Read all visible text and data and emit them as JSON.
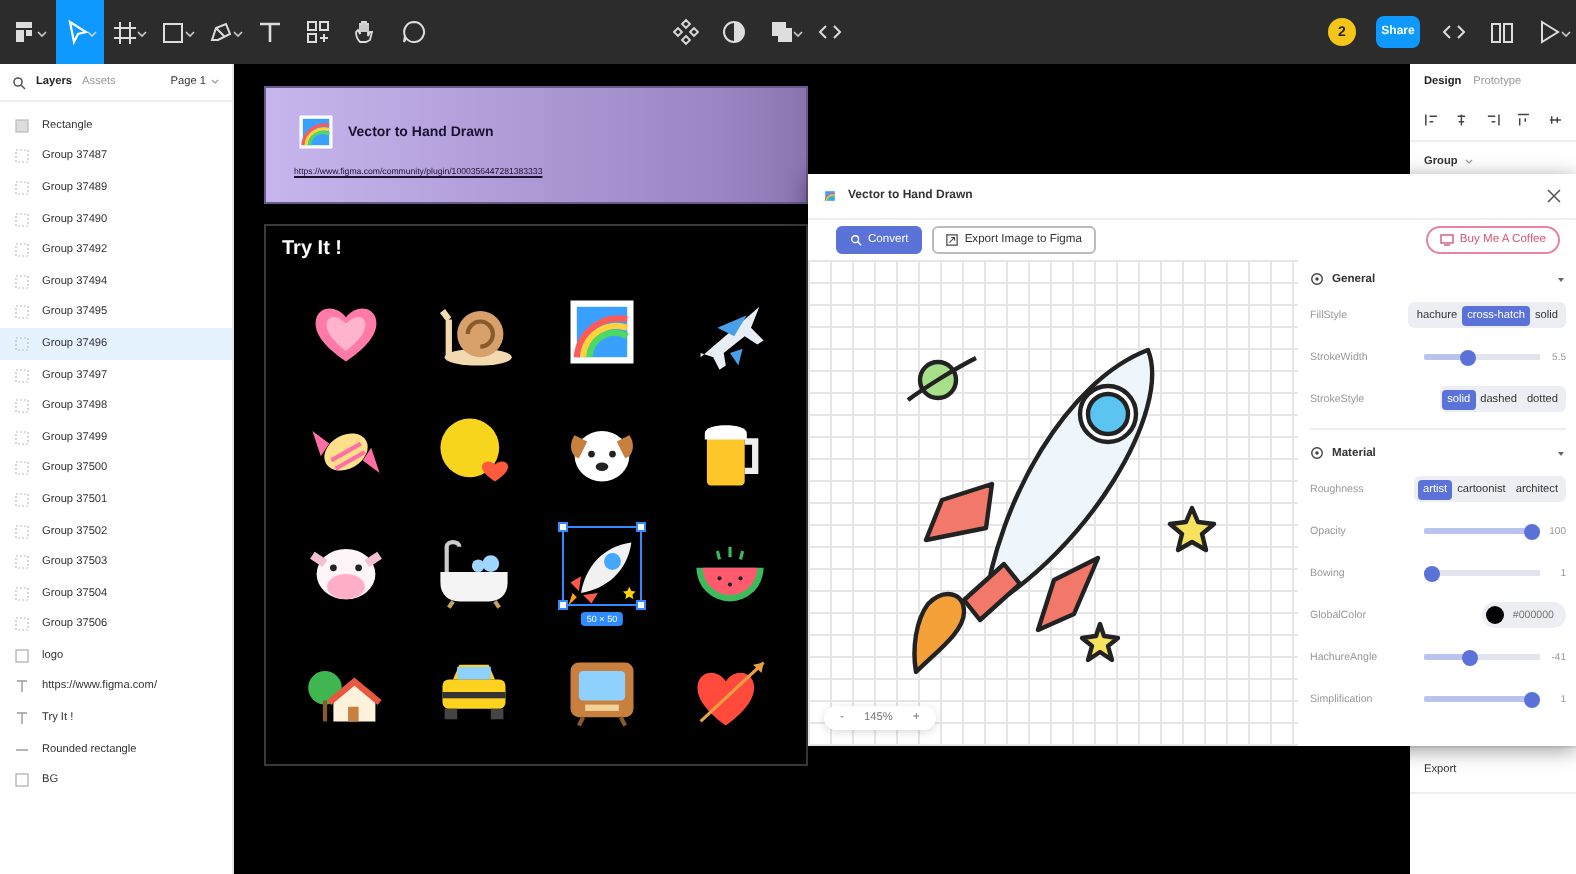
{
  "toolbar": {
    "tools": [
      {
        "kind": "menu",
        "selected": false
      },
      {
        "kind": "move",
        "selected": true
      },
      {
        "kind": "frame",
        "selected": false
      },
      {
        "kind": "shape",
        "selected": false
      },
      {
        "kind": "pen",
        "selected": false
      },
      {
        "kind": "text",
        "selected": false
      },
      {
        "kind": "resources",
        "selected": false
      },
      {
        "kind": "hand",
        "selected": false
      },
      {
        "kind": "comment",
        "selected": false
      }
    ],
    "center_tools": [
      {
        "kind": "component"
      },
      {
        "kind": "contrast"
      },
      {
        "kind": "boolean"
      },
      {
        "kind": "code"
      }
    ],
    "avatar": "2",
    "share": "Share",
    "right_tools": [
      {
        "kind": "code"
      },
      {
        "kind": "book"
      },
      {
        "kind": "play"
      }
    ]
  },
  "layers_panel": {
    "tabs": [
      {
        "label": "Layers",
        "selected": true
      },
      {
        "label": "Assets",
        "selected": false
      }
    ],
    "page": "Page 1",
    "items": [
      {
        "name": "Rectangle",
        "kind": "rect",
        "selected": false
      },
      {
        "name": "Group 37487",
        "kind": "group",
        "selected": false
      },
      {
        "name": "Group 37489",
        "kind": "group",
        "selected": false
      },
      {
        "name": "Group 37490",
        "kind": "group",
        "selected": false
      },
      {
        "name": "Group 37492",
        "kind": "group",
        "selected": false
      },
      {
        "name": "Group 37494",
        "kind": "group",
        "selected": false
      },
      {
        "name": "Group 37495",
        "kind": "group",
        "selected": false
      },
      {
        "name": "Group 37496",
        "kind": "group",
        "selected": true
      },
      {
        "name": "Group 37497",
        "kind": "group",
        "selected": false
      },
      {
        "name": "Group 37498",
        "kind": "group",
        "selected": false
      },
      {
        "name": "Group 37499",
        "kind": "group",
        "selected": false
      },
      {
        "name": "Group 37500",
        "kind": "group",
        "selected": false
      },
      {
        "name": "Group 37501",
        "kind": "group",
        "selected": false
      },
      {
        "name": "Group 37502",
        "kind": "group",
        "selected": false
      },
      {
        "name": "Group 37503",
        "kind": "group",
        "selected": false
      },
      {
        "name": "Group 37504",
        "kind": "group",
        "selected": false
      },
      {
        "name": "Group 37506",
        "kind": "group",
        "selected": false
      },
      {
        "name": "logo",
        "kind": "frame",
        "selected": false
      },
      {
        "name": "https://www.figma.com/",
        "kind": "text",
        "selected": false
      },
      {
        "name": "Try It !",
        "kind": "text",
        "selected": false
      },
      {
        "name": "Rounded rectangle",
        "kind": "line",
        "selected": false
      },
      {
        "name": "BG",
        "kind": "frame",
        "selected": false
      }
    ]
  },
  "canvas": {
    "card": {
      "title": "Vector to Hand Drawn",
      "url": "https://www.figma.com/community/plugin/1000356447281383333"
    },
    "try_frame": {
      "title": "Try It !",
      "selection_size": "50 × 50",
      "tiles": [
        {
          "kind": "heart",
          "selected": false
        },
        {
          "kind": "snail",
          "selected": false
        },
        {
          "kind": "rainbow",
          "selected": false
        },
        {
          "kind": "plane",
          "selected": false
        },
        {
          "kind": "candy",
          "selected": false
        },
        {
          "kind": "moon",
          "selected": false
        },
        {
          "kind": "dog",
          "selected": false
        },
        {
          "kind": "beer",
          "selected": false
        },
        {
          "kind": "cow",
          "selected": false
        },
        {
          "kind": "bathtub",
          "selected": false
        },
        {
          "kind": "rocket",
          "selected": true
        },
        {
          "kind": "watermelon",
          "selected": false
        },
        {
          "kind": "house",
          "selected": false
        },
        {
          "kind": "taxi",
          "selected": false
        },
        {
          "kind": "tv",
          "selected": false
        },
        {
          "kind": "heartarrow",
          "selected": false
        }
      ]
    }
  },
  "design_panel": {
    "tabs": [
      {
        "label": "Design",
        "selected": true
      },
      {
        "label": "Prototype",
        "selected": false
      }
    ],
    "section": "Group",
    "export": "Export"
  },
  "plugin": {
    "title": "Vector to Hand Drawn",
    "convert": "Convert",
    "export": "Export Image to Figma",
    "coffee": "Buy Me A Coffee",
    "zoom": {
      "minus": "-",
      "value": "145%",
      "plus": "+"
    },
    "sections": [
      {
        "title": "General",
        "settings": [
          {
            "kind": "segmented",
            "label": "FillStyle",
            "options": [
              {
                "label": "hachure",
                "selected": false
              },
              {
                "label": "cross-hatch",
                "selected": true
              },
              {
                "label": "solid",
                "selected": false
              }
            ]
          },
          {
            "kind": "slider",
            "label": "StrokeWidth",
            "level": 0.38,
            "reading": "5.5"
          },
          {
            "kind": "segmented",
            "label": "StrokeStyle",
            "options": [
              {
                "label": "solid",
                "selected": true
              },
              {
                "label": "dashed",
                "selected": false
              },
              {
                "label": "dotted",
                "selected": false
              }
            ]
          }
        ]
      },
      {
        "title": "Material",
        "settings": [
          {
            "kind": "segmented",
            "label": "Roughness",
            "options": [
              {
                "label": "artist",
                "selected": true
              },
              {
                "label": "cartoonist",
                "selected": false
              },
              {
                "label": "architect",
                "selected": false
              }
            ]
          },
          {
            "kind": "slider",
            "label": "Opacity",
            "level": 1,
            "reading": "100"
          },
          {
            "kind": "slider",
            "label": "Bowing",
            "level": 0.05,
            "reading": "1"
          },
          {
            "kind": "color",
            "label": "GlobalColor",
            "color": "#000000",
            "value": "#000000"
          },
          {
            "kind": "slider",
            "label": "HachureAngle",
            "level": 0.4,
            "reading": "-41"
          },
          {
            "kind": "slider",
            "label": "Simplification",
            "level": 0.95,
            "reading": "1"
          }
        ]
      }
    ]
  }
}
